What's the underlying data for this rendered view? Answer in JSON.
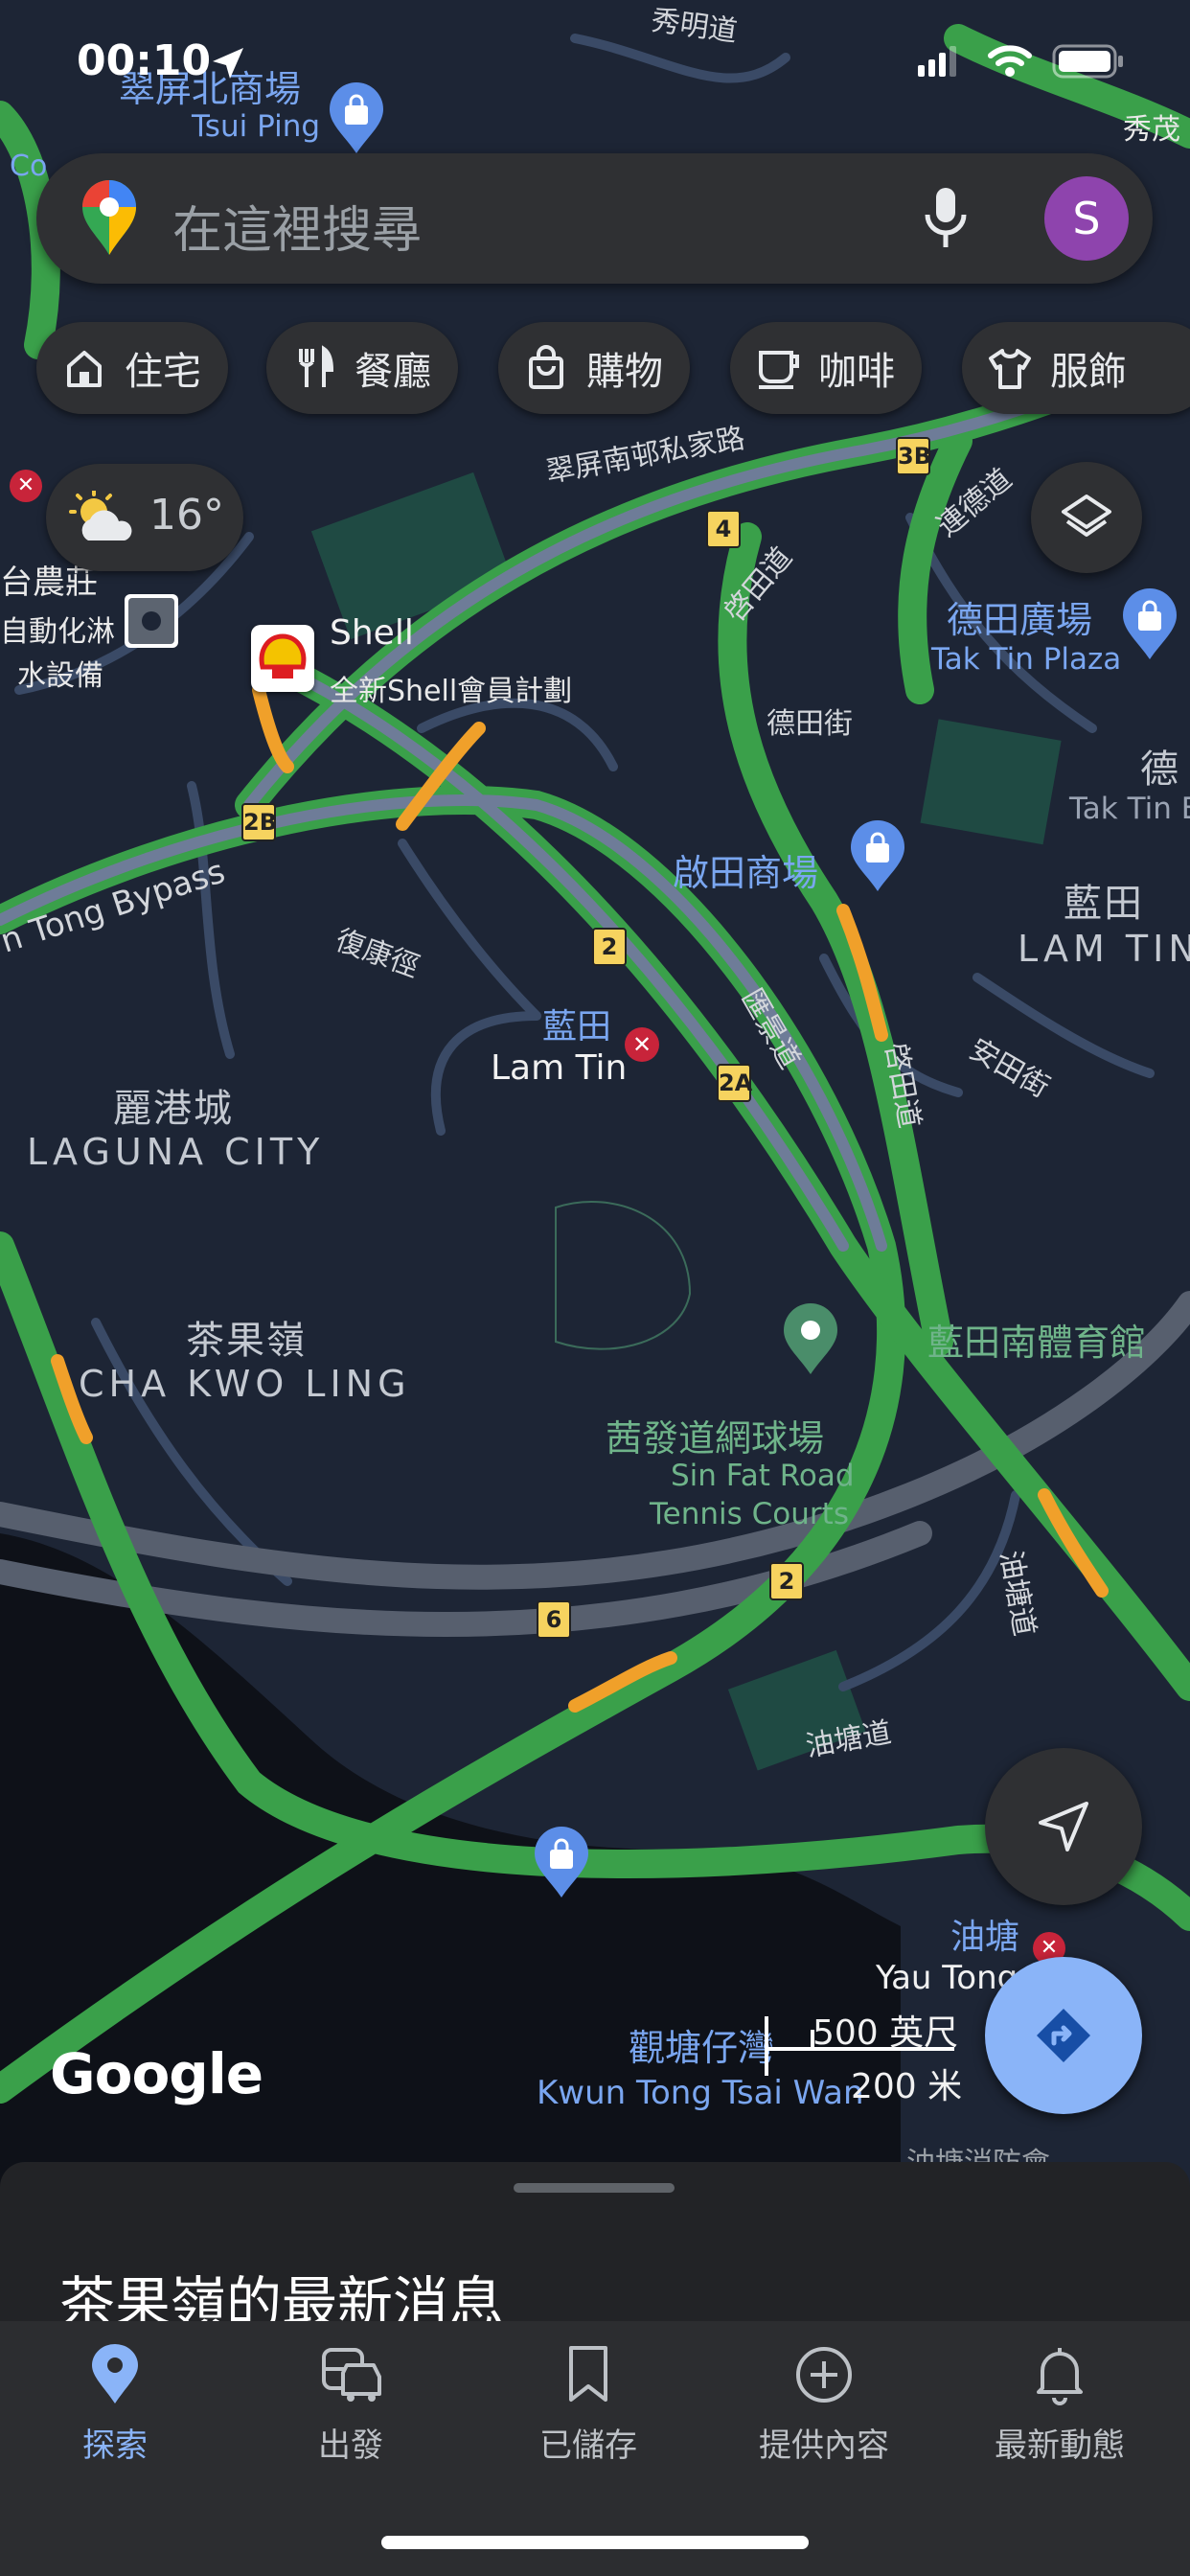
{
  "status_bar": {
    "time": "00:10"
  },
  "search": {
    "placeholder": "在這裡搜尋",
    "avatar_letter": "S"
  },
  "chips": [
    {
      "label": "住宅",
      "icon": "home-icon"
    },
    {
      "label": "餐廳",
      "icon": "restaurant-icon"
    },
    {
      "label": "購物",
      "icon": "shopping-bag-icon"
    },
    {
      "label": "咖啡",
      "icon": "coffee-icon"
    },
    {
      "label": "服飾",
      "icon": "shirt-icon"
    }
  ],
  "weather": {
    "temperature": "16°",
    "icon": "partly-cloudy-icon"
  },
  "map": {
    "places": {
      "tsui_ping_mall_zh": "翠屏北商場",
      "tsui_ping_mall_en": "Tsui Ping",
      "tak_tin_plaza_zh": "德田廣場",
      "tak_tin_plaza_en": "Tak Tin Plaza",
      "tak_tin_zh": "德",
      "tak_tin_en": "Tak Tin E",
      "kai_tin_zh": "啟田商場",
      "lam_tin_area_zh": "藍田",
      "lam_tin_area_en": "LAM TIN",
      "lam_tin_station_zh": "藍田",
      "lam_tin_station_en": "Lam Tin",
      "laguna_zh": "麗港城",
      "laguna_en": "LAGUNA CITY",
      "cha_kwo_ling_zh": "茶果嶺",
      "cha_kwo_ling_en": "CHA KWO LING",
      "sports_centre_zh": "藍田南體育館",
      "tennis_zh": "茜發道網球場",
      "tennis_en_1": "Sin Fat Road",
      "tennis_en_2": "Tennis Courts",
      "yau_tong_zh": "油塘",
      "yau_tong_en": "Yau Tong",
      "kwun_tong_zh": "觀塘仔灣",
      "kwun_tong_en": "Kwun Tong Tsai Wan",
      "shell_name": "Shell",
      "shell_sub": "全新Shell會員計劃",
      "left_edge_1": "台農莊",
      "left_edge_2": "自動化淋",
      "left_edge_3": "水設備",
      "corner_left": "Co",
      "corner_right": "秀茂",
      "bottom_cut": "油塘消防會"
    },
    "roads": {
      "sau_ming": "秀明道",
      "tsui_ping_private": "翠屏南邨私家路",
      "kai_tin": "啓田道",
      "tak_tin_st": "德田街",
      "lian_tak": "連德道",
      "hong_kong": "復康徑",
      "bypass": "n Tong Bypass",
      "wai_fat": "匯景道",
      "kai_tin_2": "啓田道",
      "on_tin": "安田街",
      "yau_tong_road": "油塘道",
      "yau_tong_road_2": "油塘道"
    },
    "shields": [
      "3B",
      "4",
      "2B",
      "2",
      "2A",
      "2",
      "6"
    ],
    "scale_ft": "500 英尺",
    "scale_m": "200 米",
    "google_logo": "Google"
  },
  "sheet": {
    "title": "茶果嶺的最新消息"
  },
  "bottom_nav": [
    {
      "label": "探索",
      "icon": "explore-pin-icon",
      "active": true
    },
    {
      "label": "出發",
      "icon": "commute-icon",
      "active": false
    },
    {
      "label": "已儲存",
      "icon": "bookmark-icon",
      "active": false
    },
    {
      "label": "提供內容",
      "icon": "add-circle-icon",
      "active": false
    },
    {
      "label": "最新動態",
      "icon": "bell-icon",
      "active": false
    }
  ],
  "colors": {
    "map_bg": "#1d2535",
    "road_green": "#3aa04a",
    "road_orange": "#f0a02a",
    "accent_blue": "#8ab4f8",
    "chip_bg": "#2f3033"
  }
}
